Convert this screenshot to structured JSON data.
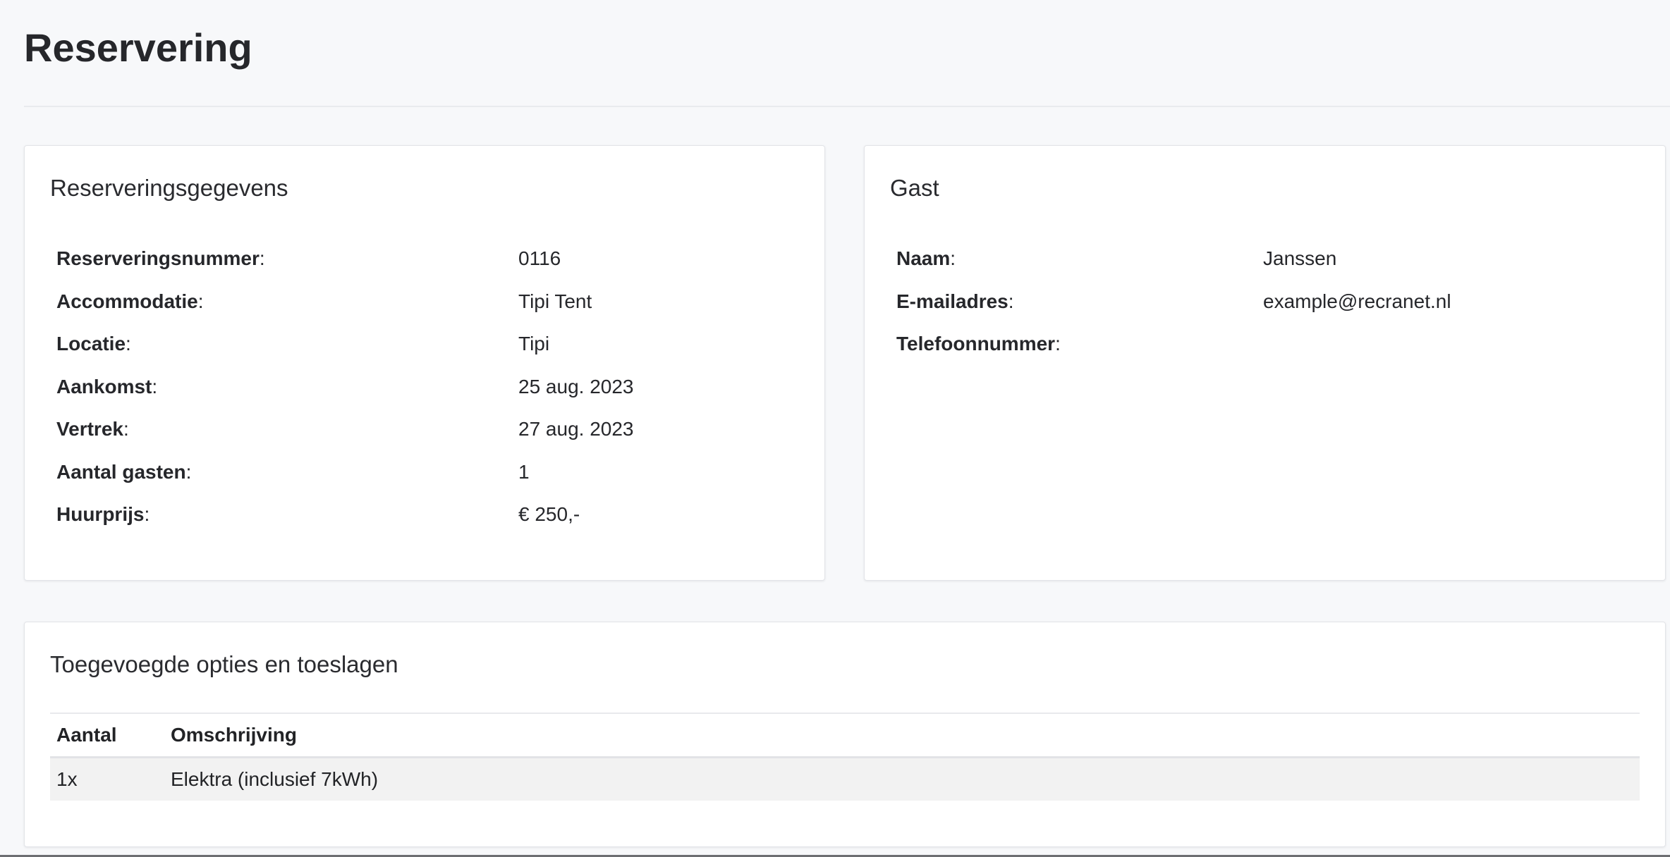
{
  "page": {
    "title": "Reservering"
  },
  "reservation": {
    "title": "Reserveringsgegevens",
    "rows": [
      {
        "label": "Reserveringsnummer",
        "value": "0116"
      },
      {
        "label": "Accommodatie",
        "value": "Tipi Tent"
      },
      {
        "label": "Locatie",
        "value": "Tipi"
      },
      {
        "label": "Aankomst",
        "value": "25 aug. 2023"
      },
      {
        "label": "Vertrek",
        "value": "27 aug. 2023"
      },
      {
        "label": "Aantal gasten",
        "value": "1"
      },
      {
        "label": "Huurprijs",
        "value": "€ 250,-"
      }
    ]
  },
  "guest": {
    "title": "Gast",
    "rows": [
      {
        "label": "Naam",
        "value": "Janssen"
      },
      {
        "label": "E-mailadres",
        "value": "example@recranet.nl"
      },
      {
        "label": "Telefoonnummer",
        "value": ""
      }
    ]
  },
  "options": {
    "title": "Toegevoegde opties en toeslagen",
    "columns": [
      "Aantal",
      "Omschrijving"
    ],
    "rows": [
      {
        "quantity": "1x",
        "description": "Elektra (inclusief 7kWh)"
      }
    ]
  },
  "colors": {
    "background": "#f7f8fa",
    "card": "#ffffff",
    "text": "#26272b",
    "row_highlight": "#f2f2f2"
  }
}
